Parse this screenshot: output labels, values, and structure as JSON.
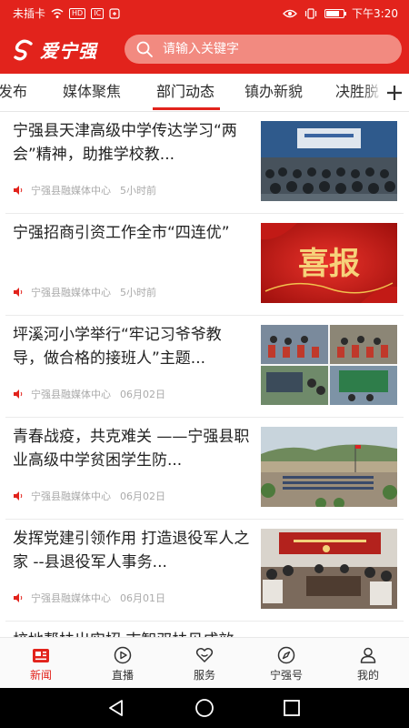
{
  "status_bar": {
    "carrier": "未插卡",
    "chip1": "HD",
    "chip2": "IC",
    "time": "下午3:20",
    "battery_level": 0.8
  },
  "header": {
    "logo_text": "爱宁强",
    "search_placeholder": "请输入关键字",
    "brand_color": "#e2231c"
  },
  "tabs": {
    "items": [
      "强发布",
      "媒体聚焦",
      "部门动态",
      "镇办新貌",
      "决胜脱"
    ],
    "active_index": 2,
    "add_icon": "plus-icon"
  },
  "news": [
    {
      "title": "宁强县天津高级中学传达学习“两会”精神，助推学校教...",
      "source": "宁强县融媒体中心",
      "time": "5小时前",
      "thumb": "auditorium-meeting-photo"
    },
    {
      "title": "宁强招商引资工作全市“四连优”",
      "source": "宁强县融媒体中心",
      "time": "5小时前",
      "thumb": "xibao-red-banner",
      "thumb_text": "喜报"
    },
    {
      "title": "坪溪河小学举行“牢记习爷爷教导，做合格的接班人”主题...",
      "source": "宁强县融媒体中心",
      "time": "06月02日",
      "thumb": "classroom-collage-photo"
    },
    {
      "title": "青春战疫，共克难关 ——宁强县职业高级中学贫困学生防...",
      "source": "宁强县融媒体中心",
      "time": "06月02日",
      "thumb": "school-yard-assembly-photo"
    },
    {
      "title": "发挥党建引领作用 打造退役军人之家 --县退役军人事务...",
      "source": "宁强县融媒体中心",
      "time": "06月01日",
      "thumb": "veterans-meeting-photo"
    },
    {
      "title": "校地帮扶出实招 志智双扶见成效 陕航院定",
      "source": "",
      "time": "",
      "thumb": ""
    }
  ],
  "bottom_nav": [
    {
      "label": "新闻",
      "icon": "news-icon",
      "active": true
    },
    {
      "label": "直播",
      "icon": "play-icon",
      "active": false
    },
    {
      "label": "服务",
      "icon": "service-icon",
      "active": false
    },
    {
      "label": "宁强号",
      "icon": "compass-icon",
      "active": false
    },
    {
      "label": "我的",
      "icon": "user-icon",
      "active": false
    }
  ],
  "system_nav": [
    "back-icon",
    "home-icon",
    "recents-icon"
  ]
}
